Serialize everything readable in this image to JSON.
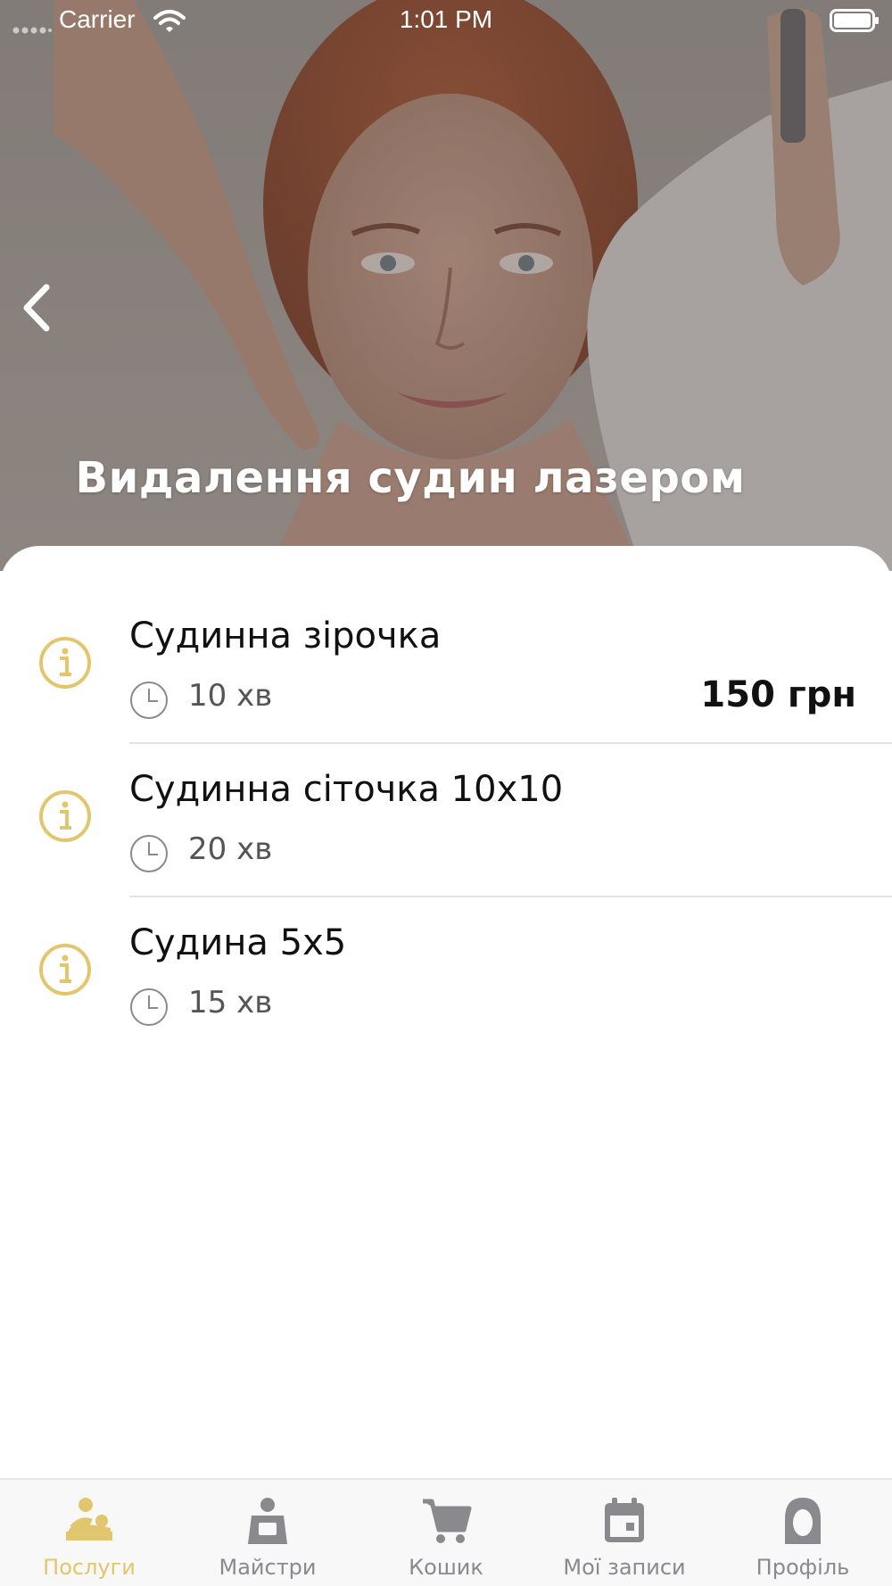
{
  "status_bar": {
    "carrier": "Carrier",
    "time": "1:01 PM"
  },
  "hero": {
    "title": "Видалення судин лазером"
  },
  "services": [
    {
      "name": "Судинна зірочка",
      "duration": "10 хв",
      "price": "150 грн"
    },
    {
      "name": "Судинна сіточка 10х10",
      "duration": "20 хв",
      "price": ""
    },
    {
      "name": "Судина 5х5",
      "duration": "15 хв",
      "price": ""
    }
  ],
  "tabs": [
    {
      "label": "Послуги",
      "icon": "massage-icon",
      "active": true
    },
    {
      "label": "Майстри",
      "icon": "master-icon",
      "active": false
    },
    {
      "label": "Кошик",
      "icon": "cart-icon",
      "active": false
    },
    {
      "label": "Мої записи",
      "icon": "calendar-icon",
      "active": false
    },
    {
      "label": "Профіль",
      "icon": "profile-icon",
      "active": false
    }
  ],
  "colors": {
    "accent": "#e2c66d",
    "inactive": "#8a8a8e",
    "text": "#111111"
  }
}
